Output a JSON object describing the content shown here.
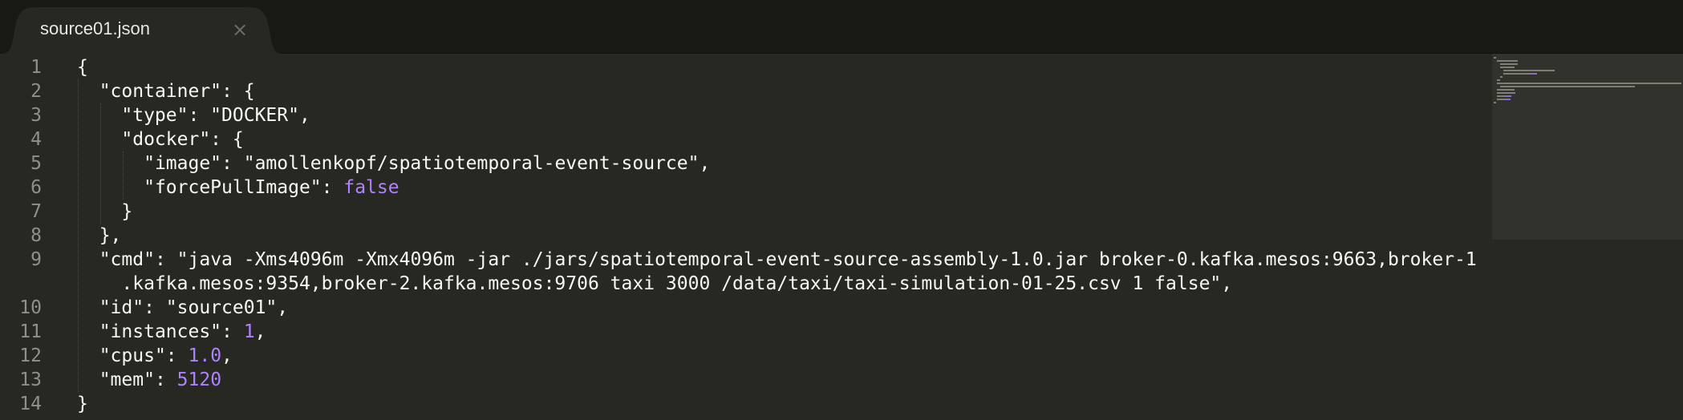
{
  "tab": {
    "title": "source01.json",
    "close_symbol": "×"
  },
  "editor": {
    "line_numbers": [
      "1",
      "2",
      "3",
      "4",
      "5",
      "6",
      "7",
      "8",
      "9",
      "",
      "10",
      "11",
      "12",
      "13",
      "14"
    ],
    "lines": {
      "l1": {
        "text": "{"
      },
      "l2": {
        "key": "\"container\"",
        "rest": ": {"
      },
      "l3": {
        "key": "\"type\"",
        "rest": ": \"DOCKER\","
      },
      "l4": {
        "key": "\"docker\"",
        "rest": ": {"
      },
      "l5": {
        "key": "\"image\"",
        "rest": ": \"amollenkopf/spatiotemporal-event-source\","
      },
      "l6": {
        "key": "\"forcePullImage\"",
        "sep": ": ",
        "value": "false"
      },
      "l7": {
        "text": "}"
      },
      "l8": {
        "text": "},"
      },
      "l9a": {
        "key": "\"cmd\"",
        "rest": ": \"java -Xms4096m -Xmx4096m -jar ./jars/spatiotemporal-event-source-assembly-1.0.jar broker-0.kafka.mesos:9663,broker-1"
      },
      "l9b": {
        "text": ".kafka.mesos:9354,broker-2.kafka.mesos:9706 taxi 3000 /data/taxi/taxi-simulation-01-25.csv 1 false\","
      },
      "l10": {
        "key": "\"id\"",
        "rest": ": \"source01\","
      },
      "l11": {
        "key": "\"instances\"",
        "sep": ": ",
        "value": "1",
        "tail": ","
      },
      "l12": {
        "key": "\"cpus\"",
        "sep": ": ",
        "value": "1.0",
        "tail": ","
      },
      "l13": {
        "key": "\"mem\"",
        "sep": ": ",
        "value": "5120"
      },
      "l14": {
        "text": "}"
      }
    }
  },
  "colors": {
    "background": "#272822",
    "tabbar": "#181814",
    "text": "#f8f8f2",
    "constant": "#ae81ff",
    "line_number": "#90908a"
  }
}
